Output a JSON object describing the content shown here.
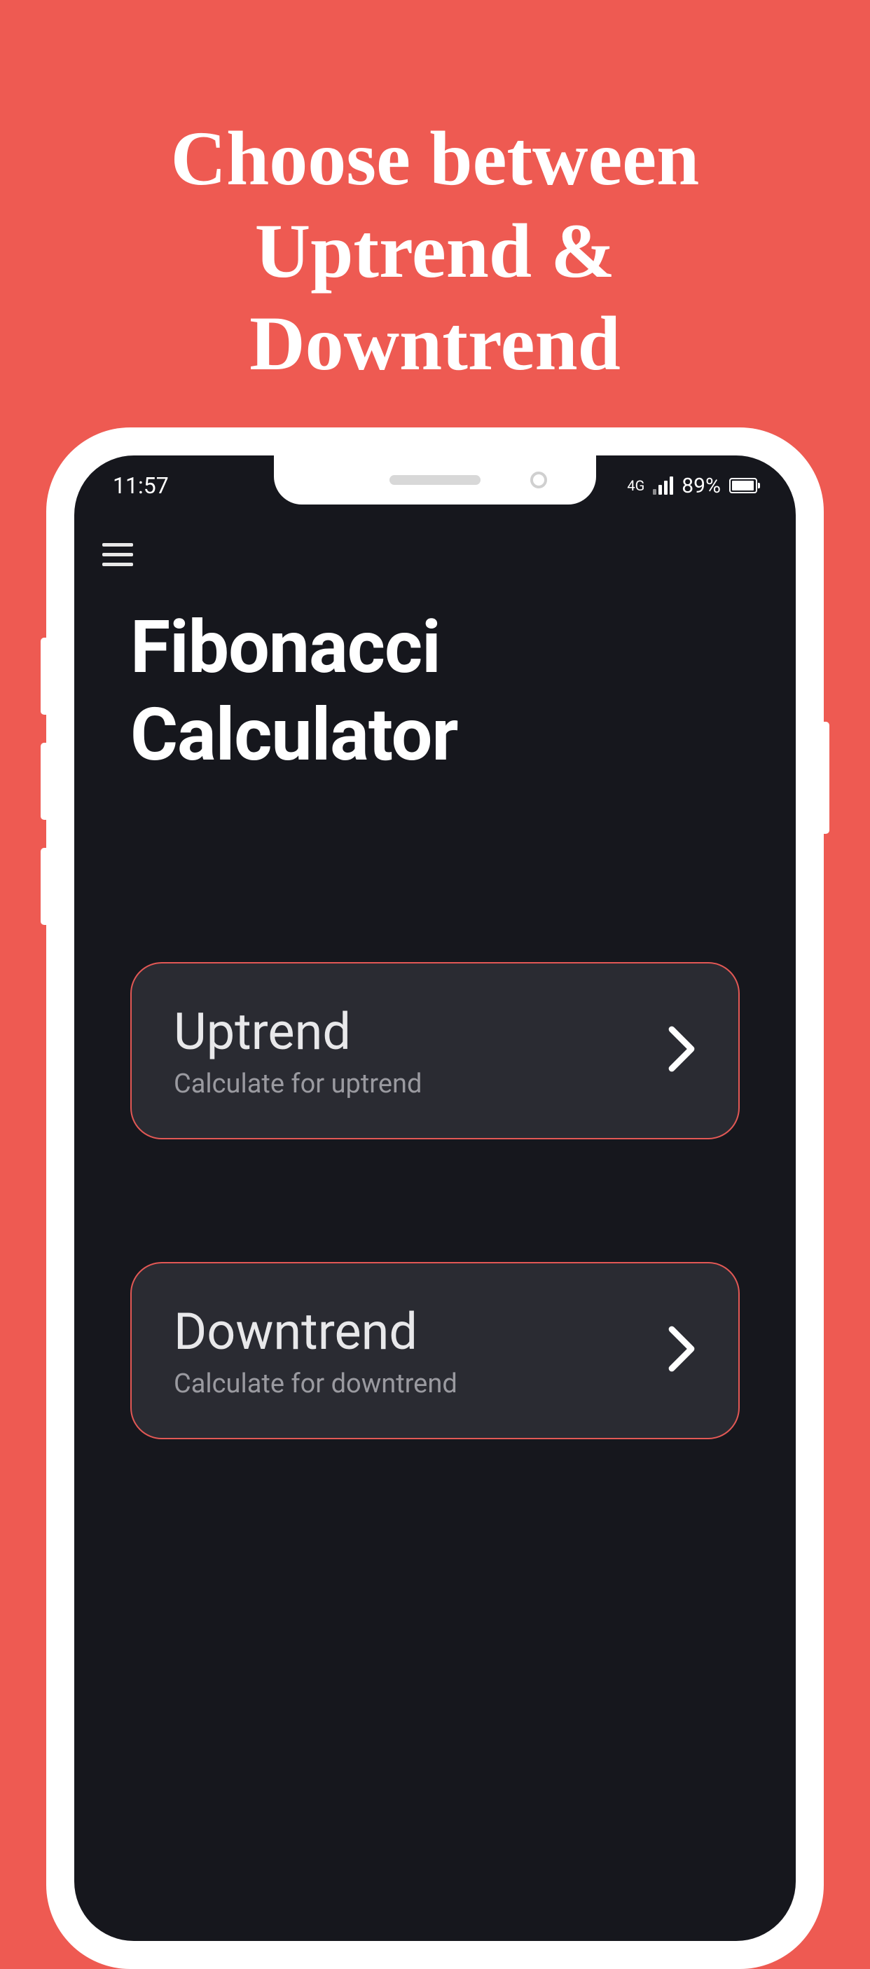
{
  "promo": {
    "heading_line1": "Choose between",
    "heading_line2": "Uptrend &",
    "heading_line3": "Downtrend"
  },
  "status_bar": {
    "time": "11:57",
    "network": "4G",
    "battery_percent": "89%"
  },
  "app": {
    "title_line1": "Fibonacci",
    "title_line2": "Calculator"
  },
  "options": [
    {
      "title": "Uptrend",
      "subtitle": "Calculate for uptrend"
    },
    {
      "title": "Downtrend",
      "subtitle": "Calculate for downtrend"
    }
  ]
}
